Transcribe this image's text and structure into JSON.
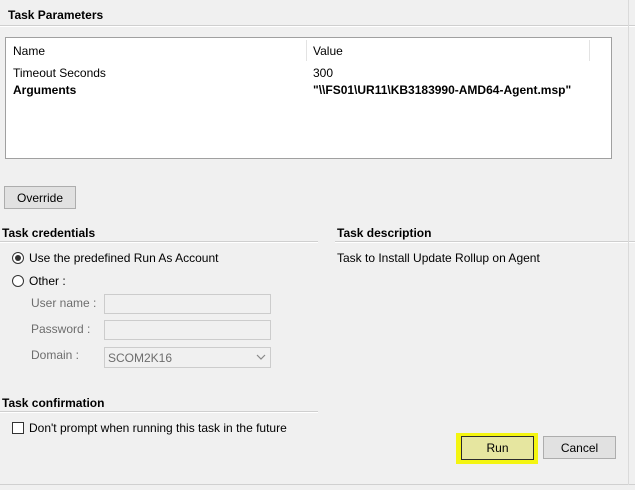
{
  "task_parameters": {
    "title": "Task Parameters",
    "columns": [
      "Name",
      "Value"
    ],
    "rows": [
      {
        "name": "Timeout Seconds",
        "value": "300",
        "bold": false
      },
      {
        "name": "Arguments",
        "value": "\"\\\\FS01\\UR11\\KB3183990-AMD64-Agent.msp\"",
        "bold": true
      }
    ],
    "override_label": "Override"
  },
  "credentials": {
    "title": "Task credentials",
    "predefined_label": "Use the predefined Run As Account",
    "other_label": "Other :",
    "selected": "predefined",
    "username_label": "User name :",
    "username_value": "",
    "password_label": "Password :",
    "password_value": "",
    "domain_label": "Domain :",
    "domain_value": "SCOM2K16"
  },
  "description": {
    "title": "Task description",
    "text": "Task to Install Update Rollup on Agent"
  },
  "confirmation": {
    "title": "Task confirmation",
    "dont_prompt_label": "Don't prompt when running this task in the future",
    "dont_prompt_checked": false
  },
  "actions": {
    "run_label": "Run",
    "cancel_label": "Cancel",
    "highlight_color": "#f4f511"
  }
}
